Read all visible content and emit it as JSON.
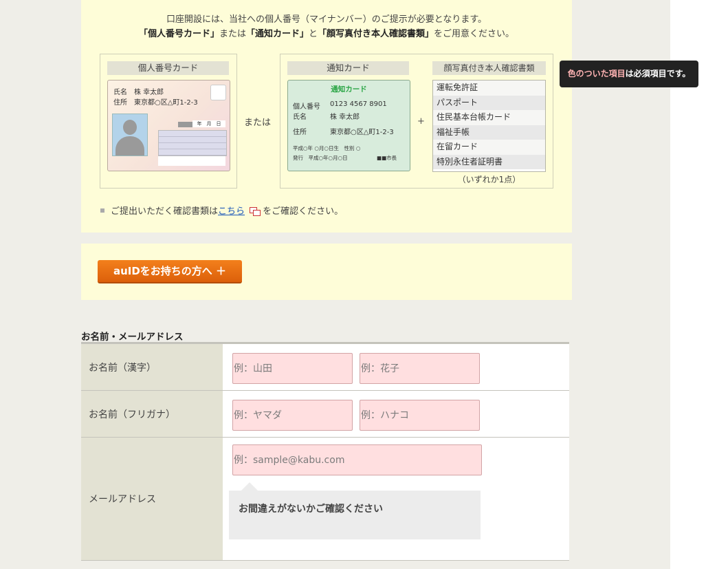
{
  "intro": {
    "line1": "口座開設には、当社への個人番号（マイナンバー）のご提示が必要となります。",
    "line2_q1": "「個人番号カード」",
    "line2_mid1": "または",
    "line2_q2": "「通知カード」",
    "line2_mid2": "と",
    "line2_q3": "「顔写真付き本人確認書類」",
    "line2_end": "をご用意ください。",
    "mynumber_card_title": "個人番号カード",
    "mynumber_card": {
      "name_label": "氏名",
      "name_value": "株 幸太郎",
      "address_label": "住所",
      "address_value": "東京都○区△町1-2-3",
      "date_text": "年　月　日"
    },
    "or_text": "または",
    "notice_card_title": "通知カード",
    "notice_card": {
      "heading": "通知カード",
      "number_label": "個人番号",
      "number_value": "0123 4567 8901",
      "name_label": "氏名",
      "name_value": "株 幸太郎",
      "address_label": "住所",
      "address_value": "東京都○区△町1-2-3",
      "birth_line": "平成○年 ○月○日生　性別 ○",
      "issue_line": "発行　平成○年○月○日",
      "mayor_text": "■■市長"
    },
    "plus_text": "+",
    "photo_id_title": "顔写真付き本人確認書類",
    "photo_id_items": [
      "運転免許証",
      "パスポート",
      "住民基本台帳カード",
      "福祉手帳",
      "在留カード",
      "特別永住者証明書"
    ],
    "photo_id_note": "（いずれか1点）",
    "confirm_prefix": "ご提出いただく確認書類は",
    "confirm_link": "こちら",
    "confirm_suffix": "をご確認ください。"
  },
  "auid_button": "auIDをお持ちの方へ ＋",
  "tooltip": {
    "highlight": "色のついた項目",
    "rest": "は必須項目です。"
  },
  "form": {
    "title": "お名前・メールアドレス",
    "rows": [
      {
        "label": "お名前（漢字）",
        "placeholder1": "例：山田",
        "placeholder2": "例：花子"
      },
      {
        "label": "お名前（フリガナ）",
        "placeholder1": "例：ヤマダ",
        "placeholder2": "例：ハナコ"
      },
      {
        "label": "メールアドレス",
        "placeholder1": "例：sample@kabu.com"
      }
    ],
    "email_confirm_note": "お間違えがないかご確認ください"
  },
  "colors": {
    "accent_orange": "#e8701a",
    "required_pink": "#ffdfe0",
    "panel_yellow": "#fefdd8"
  }
}
